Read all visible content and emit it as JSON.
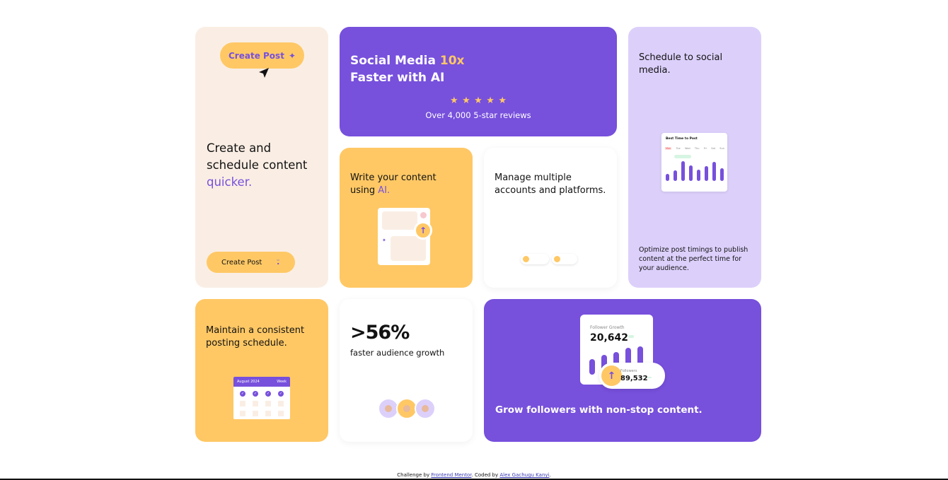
{
  "create_card": {
    "top_button_label": "Create Post",
    "title_line1": "Create and",
    "title_line2": "schedule content",
    "title_accent": "quicker.",
    "bottom_button_label": "Create Post"
  },
  "social_card": {
    "title_part1": "Social Media ",
    "title_accent": "10x",
    "title_line2": "Faster with AI",
    "stars": "★★★★★",
    "reviews": "Over 4,000 5-star reviews"
  },
  "schedule_card": {
    "title": "Schedule to social media.",
    "chart_title": "Best Time to Post",
    "days": [
      "Mon",
      "Tue",
      "Wed",
      "Thu",
      "Fri",
      "Sat",
      "Sun"
    ],
    "bar_levels": [
      0.35,
      0.5,
      0.95,
      0.75,
      0.55,
      0.7,
      0.9,
      0.6
    ],
    "subtitle": "Optimize post timings to publish content at the perfect time for your audience."
  },
  "write_card": {
    "title_part1": "Write your content using ",
    "title_accent": "AI."
  },
  "manage_card": {
    "title": "Manage multiple accounts and platforms."
  },
  "maintain_card": {
    "title": "Maintain a consistent posting schedule.",
    "calendar_month": "August 2024",
    "calendar_view": "Week"
  },
  "growth_card": {
    "big_number": ">56%",
    "subtitle": "faster audience growth"
  },
  "grow_card": {
    "stat_label": "Follower Growth",
    "stat_value": "20,642",
    "followers_label": "Followers",
    "followers_value": "89,532",
    "bar_levels": [
      0.55,
      0.7,
      0.8,
      0.95,
      1.0
    ],
    "title": "Grow followers with non-stop content."
  },
  "attribution": {
    "prefix": "Challenge by ",
    "link1": "Frontend Mentor",
    "middle": ". Coded by ",
    "link2": "Alex Gachugu Kanyi",
    "suffix": "."
  },
  "colors": {
    "purple": "#7750dc",
    "gold": "#ffc865",
    "cream": "#faeee4",
    "lavender": "#dcd0fb"
  }
}
